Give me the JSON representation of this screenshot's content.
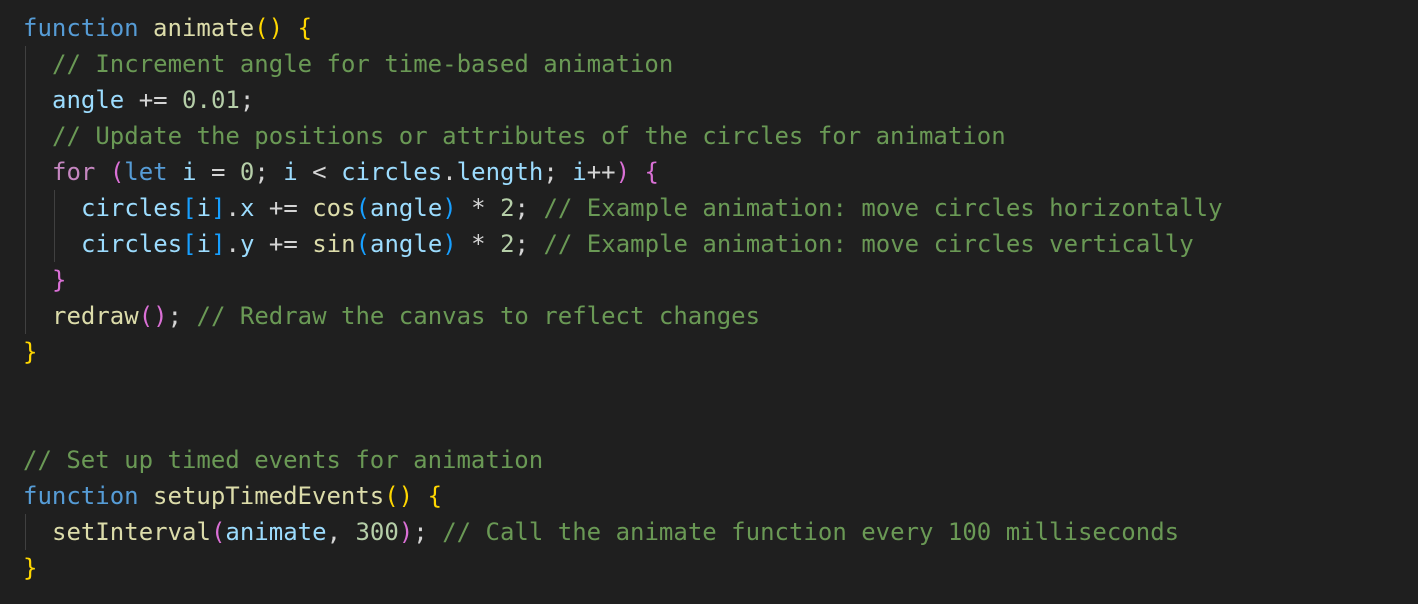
{
  "editor": {
    "theme_colors": {
      "background": "#1f1f1f",
      "keyword": "#569cd6",
      "control": "#c586c0",
      "function": "#dcdcaa",
      "variable": "#9cdcfe",
      "number": "#b5cea8",
      "comment": "#6a9955",
      "text": "#d4d4d4",
      "bracket_level1": "#ffd700",
      "bracket_level2": "#da70d6",
      "bracket_level3": "#179fff"
    },
    "lines": [
      {
        "indent": 0,
        "tokens": [
          {
            "t": "function",
            "c": "keyword"
          },
          {
            "t": " ",
            "c": "op"
          },
          {
            "t": "animate",
            "c": "fn"
          },
          {
            "t": "()",
            "c": "b1"
          },
          {
            "t": " ",
            "c": "op"
          },
          {
            "t": "{",
            "c": "b1"
          }
        ]
      },
      {
        "indent": 1,
        "tokens": [
          {
            "t": "// Increment angle for time-based animation",
            "c": "comment"
          }
        ]
      },
      {
        "indent": 1,
        "tokens": [
          {
            "t": "angle",
            "c": "var"
          },
          {
            "t": " += ",
            "c": "op"
          },
          {
            "t": "0.01",
            "c": "num"
          },
          {
            "t": ";",
            "c": "punct"
          }
        ]
      },
      {
        "indent": 1,
        "tokens": [
          {
            "t": "// Update the positions or attributes of the circles for animation",
            "c": "comment"
          }
        ]
      },
      {
        "indent": 1,
        "tokens": [
          {
            "t": "for",
            "c": "control"
          },
          {
            "t": " ",
            "c": "op"
          },
          {
            "t": "(",
            "c": "b2"
          },
          {
            "t": "let",
            "c": "keyword"
          },
          {
            "t": " ",
            "c": "op"
          },
          {
            "t": "i",
            "c": "var"
          },
          {
            "t": " = ",
            "c": "op"
          },
          {
            "t": "0",
            "c": "num"
          },
          {
            "t": "; ",
            "c": "punct"
          },
          {
            "t": "i",
            "c": "var"
          },
          {
            "t": " < ",
            "c": "op"
          },
          {
            "t": "circles",
            "c": "var"
          },
          {
            "t": ".",
            "c": "punct"
          },
          {
            "t": "length",
            "c": "var"
          },
          {
            "t": "; ",
            "c": "punct"
          },
          {
            "t": "i",
            "c": "var"
          },
          {
            "t": "++",
            "c": "op"
          },
          {
            "t": ")",
            "c": "b2"
          },
          {
            "t": " ",
            "c": "op"
          },
          {
            "t": "{",
            "c": "b2"
          }
        ]
      },
      {
        "indent": 2,
        "tokens": [
          {
            "t": "circles",
            "c": "var"
          },
          {
            "t": "[",
            "c": "b3"
          },
          {
            "t": "i",
            "c": "var"
          },
          {
            "t": "]",
            "c": "b3"
          },
          {
            "t": ".",
            "c": "punct"
          },
          {
            "t": "x",
            "c": "var"
          },
          {
            "t": " += ",
            "c": "op"
          },
          {
            "t": "cos",
            "c": "fn"
          },
          {
            "t": "(",
            "c": "b3"
          },
          {
            "t": "angle",
            "c": "var"
          },
          {
            "t": ")",
            "c": "b3"
          },
          {
            "t": " * ",
            "c": "op"
          },
          {
            "t": "2",
            "c": "num"
          },
          {
            "t": "; ",
            "c": "punct"
          },
          {
            "t": "// Example animation: move circles horizontally",
            "c": "comment"
          }
        ]
      },
      {
        "indent": 2,
        "tokens": [
          {
            "t": "circles",
            "c": "var"
          },
          {
            "t": "[",
            "c": "b3"
          },
          {
            "t": "i",
            "c": "var"
          },
          {
            "t": "]",
            "c": "b3"
          },
          {
            "t": ".",
            "c": "punct"
          },
          {
            "t": "y",
            "c": "var"
          },
          {
            "t": " += ",
            "c": "op"
          },
          {
            "t": "sin",
            "c": "fn"
          },
          {
            "t": "(",
            "c": "b3"
          },
          {
            "t": "angle",
            "c": "var"
          },
          {
            "t": ")",
            "c": "b3"
          },
          {
            "t": " * ",
            "c": "op"
          },
          {
            "t": "2",
            "c": "num"
          },
          {
            "t": "; ",
            "c": "punct"
          },
          {
            "t": "// Example animation: move circles vertically",
            "c": "comment"
          }
        ]
      },
      {
        "indent": 1,
        "tokens": [
          {
            "t": "}",
            "c": "b2"
          }
        ]
      },
      {
        "indent": 1,
        "tokens": [
          {
            "t": "redraw",
            "c": "fn"
          },
          {
            "t": "()",
            "c": "b2"
          },
          {
            "t": "; ",
            "c": "punct"
          },
          {
            "t": "// Redraw the canvas to reflect changes",
            "c": "comment"
          }
        ]
      },
      {
        "indent": 0,
        "tokens": [
          {
            "t": "}",
            "c": "b1"
          }
        ]
      },
      {
        "indent": 0,
        "tokens": []
      },
      {
        "indent": 0,
        "tokens": []
      },
      {
        "indent": 0,
        "tokens": [
          {
            "t": "// Set up timed events for animation",
            "c": "comment"
          }
        ]
      },
      {
        "indent": 0,
        "tokens": [
          {
            "t": "function",
            "c": "keyword"
          },
          {
            "t": " ",
            "c": "op"
          },
          {
            "t": "setupTimedEvents",
            "c": "fn"
          },
          {
            "t": "()",
            "c": "b1"
          },
          {
            "t": " ",
            "c": "op"
          },
          {
            "t": "{",
            "c": "b1"
          }
        ]
      },
      {
        "indent": 1,
        "tokens": [
          {
            "t": "setInterval",
            "c": "fn"
          },
          {
            "t": "(",
            "c": "b2"
          },
          {
            "t": "animate",
            "c": "var"
          },
          {
            "t": ", ",
            "c": "punct"
          },
          {
            "t": "300",
            "c": "num"
          },
          {
            "t": ")",
            "c": "b2"
          },
          {
            "t": "; ",
            "c": "punct"
          },
          {
            "t": "// Call the animate function every 100 milliseconds",
            "c": "comment"
          }
        ]
      },
      {
        "indent": 0,
        "tokens": [
          {
            "t": "}",
            "c": "b1"
          }
        ]
      }
    ]
  }
}
